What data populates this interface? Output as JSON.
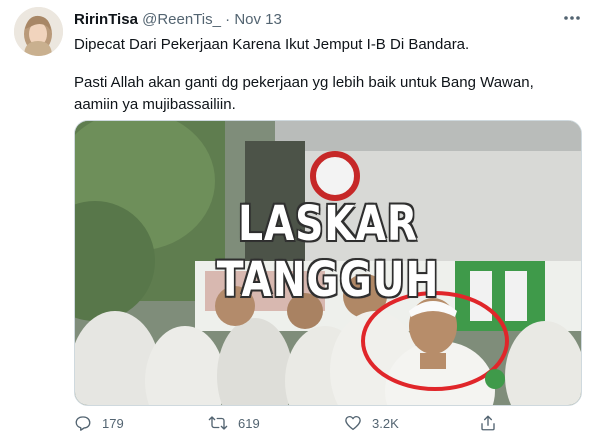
{
  "tweet": {
    "author": {
      "display_name": "RirinTisa",
      "handle": "@ReenTis_",
      "separator": "·",
      "date": "Nov 13"
    },
    "text_line1": "Dipecat Dari Pekerjaan Karena Ikut Jemput I-B Di Bandara.",
    "text_line2": "Pasti Allah akan ganti dg pekerjaan yg lebih baik untuk Bang Wawan, aamiin ya mujibassailiin.",
    "media": {
      "caption": "LASKAR TANGGUH"
    },
    "actions": {
      "replies": "179",
      "retweets": "619",
      "likes": "3.2K"
    },
    "icons": {
      "more": "more-dots-icon",
      "reply": "reply-icon",
      "retweet": "retweet-icon",
      "like": "heart-icon",
      "share": "share-icon"
    },
    "colors": {
      "muted": "#536471",
      "text": "#0f1419",
      "border": "#cfd9de"
    }
  }
}
